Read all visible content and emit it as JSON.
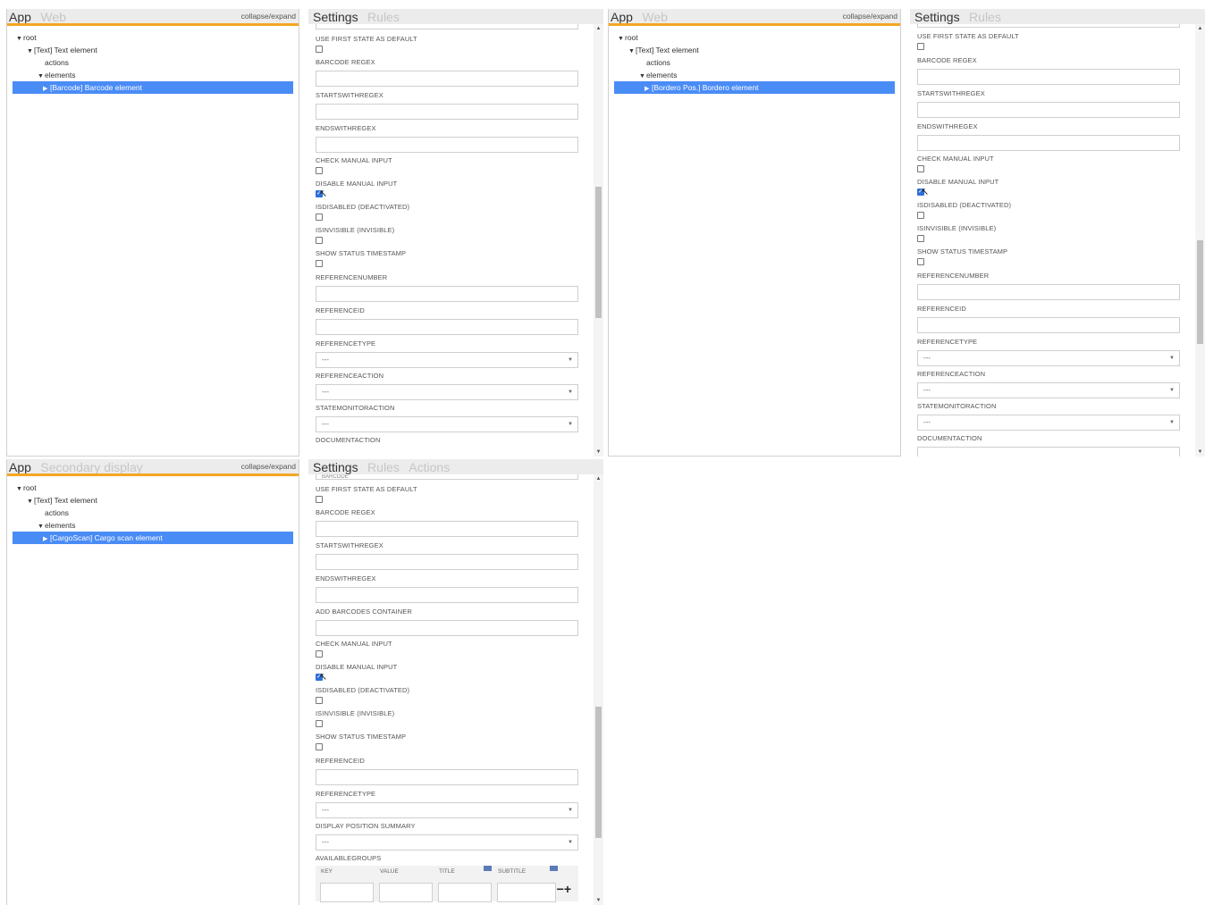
{
  "colors": {
    "accent": "#f5a623",
    "selection": "#4a8cf6",
    "checkbox": "#2e6fd8"
  },
  "panel1": {
    "app": {
      "tabs": [
        "App",
        "Web"
      ],
      "collapse_label": "collapse/expand",
      "tree": [
        {
          "label": "root",
          "toggle": "▼"
        },
        {
          "label": "[Text] Text element",
          "toggle": "▼"
        },
        {
          "label": "actions",
          "toggle": ""
        },
        {
          "label": "elements",
          "toggle": "▼"
        },
        {
          "label": "[Barcode] Barcode element",
          "toggle": "▶"
        }
      ]
    },
    "settings": {
      "tabs": [
        "Settings",
        "Rules"
      ],
      "use_first_state": "USE FIRST STATE AS DEFAULT",
      "barcode_regex": "BARCODE REGEX",
      "startswithregex": "STARTSWITHREGEX",
      "endswithregex": "ENDSWITHREGEX",
      "check_manual": "CHECK MANUAL INPUT",
      "disable_manual": "DISABLE MANUAL INPUT",
      "isdisabled": "ISDISABLED (DEACTIVATED)",
      "isinvisible": "ISINVISIBLE (INVISIBLE)",
      "show_status": "SHOW STATUS TIMESTAMP",
      "referencenumber": "REFERENCENUMBER",
      "referenceid": "REFERENCEID",
      "referencetype": "REFERENCETYPE",
      "referenceaction": "REFERENCEACTION",
      "statemonitoraction": "STATEMONITORACTION",
      "documentaction": "DOCUMENTACTION",
      "select_value": "---"
    }
  },
  "panel2": {
    "app": {
      "tabs": [
        "App",
        "Web"
      ],
      "collapse_label": "collapse/expand",
      "tree": [
        {
          "label": "root",
          "toggle": "▼"
        },
        {
          "label": "[Text] Text element",
          "toggle": "▼"
        },
        {
          "label": "actions",
          "toggle": ""
        },
        {
          "label": "elements",
          "toggle": "▼"
        },
        {
          "label": "[Bordero Pos.] Bordero element",
          "toggle": "▶"
        }
      ]
    },
    "settings": {
      "tabs": [
        "Settings",
        "Rules"
      ],
      "use_first_state": "USE FIRST STATE AS DEFAULT",
      "barcode_regex": "BARCODE REGEX",
      "startswithregex": "STARTSWITHREGEX",
      "endswithregex": "ENDSWITHREGEX",
      "check_manual": "CHECK MANUAL INPUT",
      "disable_manual": "DISABLE MANUAL INPUT",
      "isdisabled": "ISDISABLED (DEACTIVATED)",
      "isinvisible": "ISINVISIBLE (INVISIBLE)",
      "show_status": "SHOW STATUS TIMESTAMP",
      "referencenumber": "REFERENCENUMBER",
      "referenceid": "REFERENCEID",
      "referencetype": "REFERENCETYPE",
      "referenceaction": "REFERENCEACTION",
      "statemonitoraction": "STATEMONITORACTION",
      "documentaction": "DOCUMENTACTION",
      "select_value": "---"
    }
  },
  "panel3": {
    "app": {
      "tabs": [
        "App",
        "Secondary display"
      ],
      "collapse_label": "collapse/expand",
      "tree": [
        {
          "label": "root",
          "toggle": "▼"
        },
        {
          "label": "[Text] Text element",
          "toggle": "▼"
        },
        {
          "label": "actions",
          "toggle": ""
        },
        {
          "label": "elements",
          "toggle": "▼"
        },
        {
          "label": "[CargoScan] Cargo scan element",
          "toggle": "▶"
        }
      ]
    },
    "settings": {
      "tabs": [
        "Settings",
        "Rules",
        "Actions"
      ],
      "top_cut": "BARCODE",
      "use_first_state": "USE FIRST STATE AS DEFAULT",
      "barcode_regex": "BARCODE REGEX",
      "startswithregex": "STARTSWITHREGEX",
      "endswithregex": "ENDSWITHREGEX",
      "add_barcodes": "ADD BARCODES CONTAINER",
      "check_manual": "CHECK MANUAL INPUT",
      "disable_manual": "DISABLE MANUAL INPUT",
      "isdisabled": "ISDISABLED (DEACTIVATED)",
      "isinvisible": "ISINVISIBLE (INVISIBLE)",
      "show_status": "SHOW STATUS TIMESTAMP",
      "referenceid": "REFERENCEID",
      "referencetype": "REFERENCETYPE",
      "display_position": "DISPLAY POSITION SUMMARY",
      "availablegroups": "AVAILABLEGROUPS",
      "groups_cols": [
        "KEY",
        "VALUE",
        "TITLE",
        "SUBTITLE"
      ],
      "select_value": "---",
      "pm": "−+"
    }
  }
}
